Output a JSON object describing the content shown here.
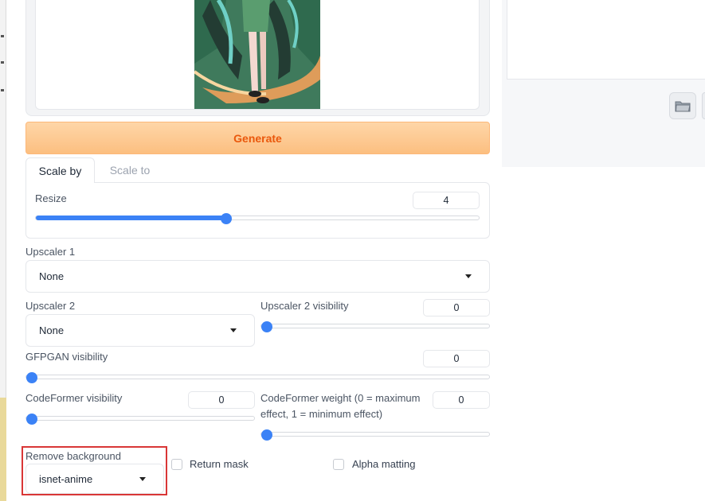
{
  "generate": {
    "label": "Generate"
  },
  "tabs": [
    {
      "label": "Scale by",
      "active": true
    },
    {
      "label": "Scale to",
      "active": false
    }
  ],
  "resize": {
    "label": "Resize",
    "value": "4",
    "fraction": 0.43
  },
  "upscaler1": {
    "label": "Upscaler 1",
    "value": "None"
  },
  "upscaler2": {
    "label": "Upscaler 2",
    "value": "None"
  },
  "upscaler2_visibility": {
    "label": "Upscaler 2 visibility",
    "value": "0",
    "fraction": 0
  },
  "gfpgan_visibility": {
    "label": "GFPGAN visibility",
    "value": "0",
    "fraction": 0
  },
  "codeformer_visibility": {
    "label": "CodeFormer visibility",
    "value": "0",
    "fraction": 0
  },
  "codeformer_weight": {
    "label_line1": "CodeFormer weight (0 = maximum",
    "label_line2": "effect, 1 = minimum effect)",
    "value": "0",
    "fraction": 0
  },
  "remove_background": {
    "label": "Remove background",
    "value": "isnet-anime"
  },
  "return_mask": {
    "label": "Return mask",
    "checked": false
  },
  "alpha_matting": {
    "label": "Alpha matting",
    "checked": false
  },
  "colors": {
    "accent": "#3b82f6",
    "generate_text": "#ea580c",
    "highlight": "#d93636"
  },
  "icons": {
    "folder": "folder-icon",
    "dropdown": "chevron-down-icon"
  }
}
